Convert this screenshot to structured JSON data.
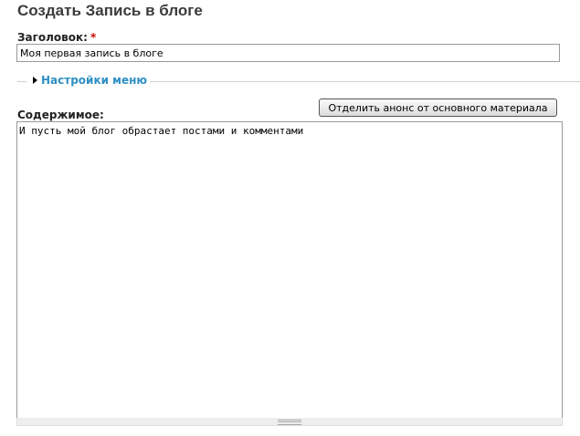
{
  "page": {
    "title": "Создать Запись в блоге"
  },
  "title_field": {
    "label": "Заголовок:",
    "required_mark": "*",
    "value": "Моя первая запись в блоге"
  },
  "menu_settings": {
    "label": "Настройки меню",
    "collapsed": true,
    "icon": "triangle-right-icon"
  },
  "body_field": {
    "label": "Содержимое:",
    "split_summary_button": "Отделить анонс от основного материала",
    "value": "И пусть мой блог обрастает постами и комментами"
  },
  "colors": {
    "link_accent": "#2e8fc4",
    "required": "#cc0000"
  }
}
